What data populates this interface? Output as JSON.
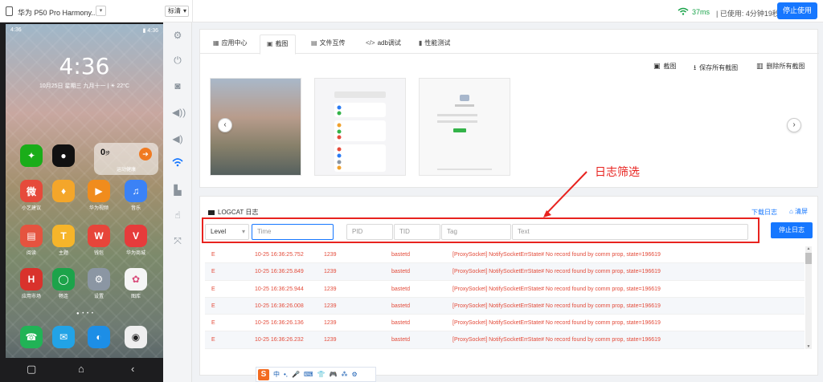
{
  "topbar": {
    "device_name": "华为 P50 Pro Harmony...",
    "quality": "标清",
    "latency": "37ms",
    "usage": "| 已使用: 4分钟19秒",
    "stop_label": "停止使用"
  },
  "phone": {
    "status_left": "4:36",
    "status_right": "▮ 4:36",
    "clock": "4:36",
    "date": "10月25日 星期三  九月十一  |  ☀ 22°C",
    "widget_steps": "0",
    "widget_steps_unit": "步",
    "widget_label": "运动健康",
    "apps": [
      {
        "label": "小艺建议",
        "color": "#e64a3b",
        "glyph": "微"
      },
      {
        "label": "",
        "color": "#f4a62a",
        "glyph": "♦"
      },
      {
        "label": "华为视频",
        "color": "#f08c1d",
        "glyph": "▶"
      },
      {
        "label": "音乐",
        "color": "#3b82f6",
        "glyph": "♫"
      },
      {
        "label": "阅读",
        "color": "#e5533f",
        "glyph": "▤"
      },
      {
        "label": "主题",
        "color": "#f6b52a",
        "glyph": "T"
      },
      {
        "label": "钱包",
        "color": "#e7453a",
        "glyph": "W"
      },
      {
        "label": "华为商城",
        "color": "#e63b3b",
        "glyph": "V"
      },
      {
        "label": "应用市场",
        "color": "#d9322c",
        "glyph": "H"
      },
      {
        "label": "畅连",
        "color": "#1ca34a",
        "glyph": "◯"
      },
      {
        "label": "设置",
        "color": "#8b96a3",
        "glyph": "⚙"
      },
      {
        "label": "图库",
        "color": "#f5f5f5",
        "glyph": "✿"
      }
    ],
    "dock": [
      {
        "color": "#21b356",
        "glyph": "☎"
      },
      {
        "color": "#22a3e6",
        "glyph": "✉"
      },
      {
        "color": "#1d8ee6",
        "glyph": "◐"
      },
      {
        "color": "#efefef",
        "glyph": "◉"
      }
    ],
    "top_apps": [
      {
        "color": "#1aad19",
        "glyph": "✦"
      },
      {
        "color": "#111111",
        "glyph": "●"
      }
    ],
    "nav": [
      "▢",
      "⌂",
      "‹"
    ]
  },
  "tools": [
    "gear-icon",
    "power-icon",
    "camera-icon",
    "volume-up-icon",
    "volume-down-icon",
    "wifi-icon",
    "sd-card-icon",
    "touch-icon",
    "fullscreen-icon"
  ],
  "tabs": [
    {
      "label": "应用中心",
      "icon": "▦"
    },
    {
      "label": "截图",
      "icon": "▣"
    },
    {
      "label": "文件互传",
      "icon": "▤"
    },
    {
      "label": "adb调试",
      "icon": "</>"
    },
    {
      "label": "性能测试",
      "icon": "▮"
    }
  ],
  "actions": {
    "capture": "截图",
    "save_all": "保存所有截图",
    "delete_all": "删除所有截图"
  },
  "logcat": {
    "title": "LOGCAT 日志",
    "download": "下载日志",
    "clear": "清屏",
    "level": "Level",
    "placeholders": {
      "time": "Time",
      "pid": "PID",
      "tid": "TID",
      "tag": "Tag",
      "text": "Text"
    },
    "stop_label": "停止日志",
    "rows": [
      {
        "level": "E",
        "time": "10-25 16:36:25.752",
        "pid": "1239",
        "tag": "bastetd",
        "text": "[ProxySocket] NotifySocketErrState# No record found by comm prop, state=196619"
      },
      {
        "level": "E",
        "time": "10-25 16:36:25.849",
        "pid": "1239",
        "tag": "bastetd",
        "text": "[ProxySocket] NotifySocketErrState# No record found by comm prop, state=196619"
      },
      {
        "level": "E",
        "time": "10-25 16:36:25.944",
        "pid": "1239",
        "tag": "bastetd",
        "text": "[ProxySocket] NotifySocketErrState# No record found by comm prop, state=196619"
      },
      {
        "level": "E",
        "time": "10-25 16:36:26.008",
        "pid": "1239",
        "tag": "bastetd",
        "text": "[ProxySocket] NotifySocketErrState# No record found by comm prop, state=196619"
      },
      {
        "level": "E",
        "time": "10-25 16:36:26.136",
        "pid": "1239",
        "tag": "bastetd",
        "text": "[ProxySocket] NotifySocketErrState# No record found by comm prop, state=196619"
      },
      {
        "level": "E",
        "time": "10-25 16:36:26.232",
        "pid": "1239",
        "tag": "bastetd",
        "text": "[ProxySocket] NotifySocketErrState# No record found by comm prop, state=196619"
      }
    ]
  },
  "annotation": {
    "text": "日志筛选",
    "color": "#e8231f"
  },
  "ime": {
    "items": [
      "中",
      "•,",
      "🎤",
      "⌨",
      "👕",
      "🎮",
      "⁂",
      "⚙"
    ]
  },
  "colors": {
    "accent": "#1677ff",
    "error": "#e34b3a",
    "latency": "#1aa34a"
  }
}
